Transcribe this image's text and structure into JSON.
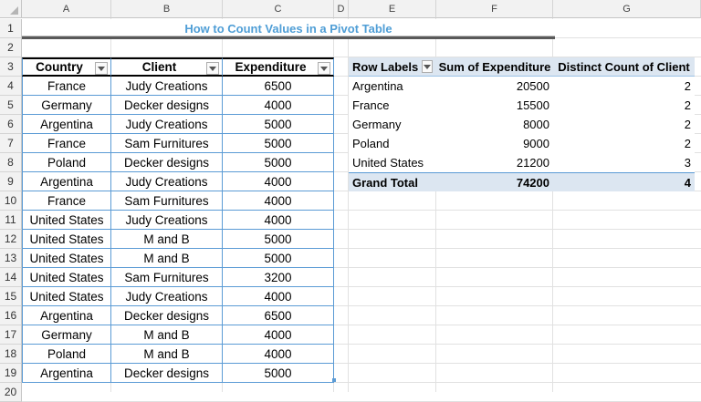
{
  "sheet": {
    "columns": [
      "A",
      "B",
      "C",
      "D",
      "E",
      "F",
      "G"
    ],
    "rows": [
      "1",
      "2",
      "3",
      "4",
      "5",
      "6",
      "7",
      "8",
      "9",
      "10",
      "11",
      "12",
      "13",
      "14",
      "15",
      "16",
      "17",
      "18",
      "19",
      "20"
    ]
  },
  "title": "How to Count Values in a Pivot Table",
  "source_table": {
    "headers": [
      "Country",
      "Client",
      "Expenditure"
    ],
    "rows": [
      [
        "France",
        "Judy Creations",
        "6500"
      ],
      [
        "Germany",
        "Decker designs",
        "4000"
      ],
      [
        "Argentina",
        "Judy Creations",
        "5000"
      ],
      [
        "France",
        "Sam Furnitures",
        "5000"
      ],
      [
        "Poland",
        "Decker designs",
        "5000"
      ],
      [
        "Argentina",
        "Judy Creations",
        "4000"
      ],
      [
        "France",
        "Sam Furnitures",
        "4000"
      ],
      [
        "United States",
        "Judy Creations",
        "4000"
      ],
      [
        "United States",
        "M and B",
        "5000"
      ],
      [
        "United States",
        "M and B",
        "5000"
      ],
      [
        "United States",
        "Sam Furnitures",
        "3200"
      ],
      [
        "United States",
        "Judy Creations",
        "4000"
      ],
      [
        "Argentina",
        "Decker designs",
        "6500"
      ],
      [
        "Germany",
        "M and B",
        "4000"
      ],
      [
        "Poland",
        "M and B",
        "4000"
      ],
      [
        "Argentina",
        "Decker designs",
        "5000"
      ]
    ]
  },
  "pivot": {
    "headers": [
      "Row Labels",
      "Sum of Expenditure",
      "Distinct Count of Client"
    ],
    "rows": [
      [
        "Argentina",
        "20500",
        "2"
      ],
      [
        "France",
        "15500",
        "2"
      ],
      [
        "Germany",
        "8000",
        "2"
      ],
      [
        "Poland",
        "9000",
        "2"
      ],
      [
        "United States",
        "21200",
        "3"
      ]
    ],
    "total": [
      "Grand Total",
      "74200",
      "4"
    ]
  },
  "colors": {
    "title": "#4f9ed6",
    "table_border": "#5b9bd5",
    "pivot_header": "#dce6f1"
  }
}
